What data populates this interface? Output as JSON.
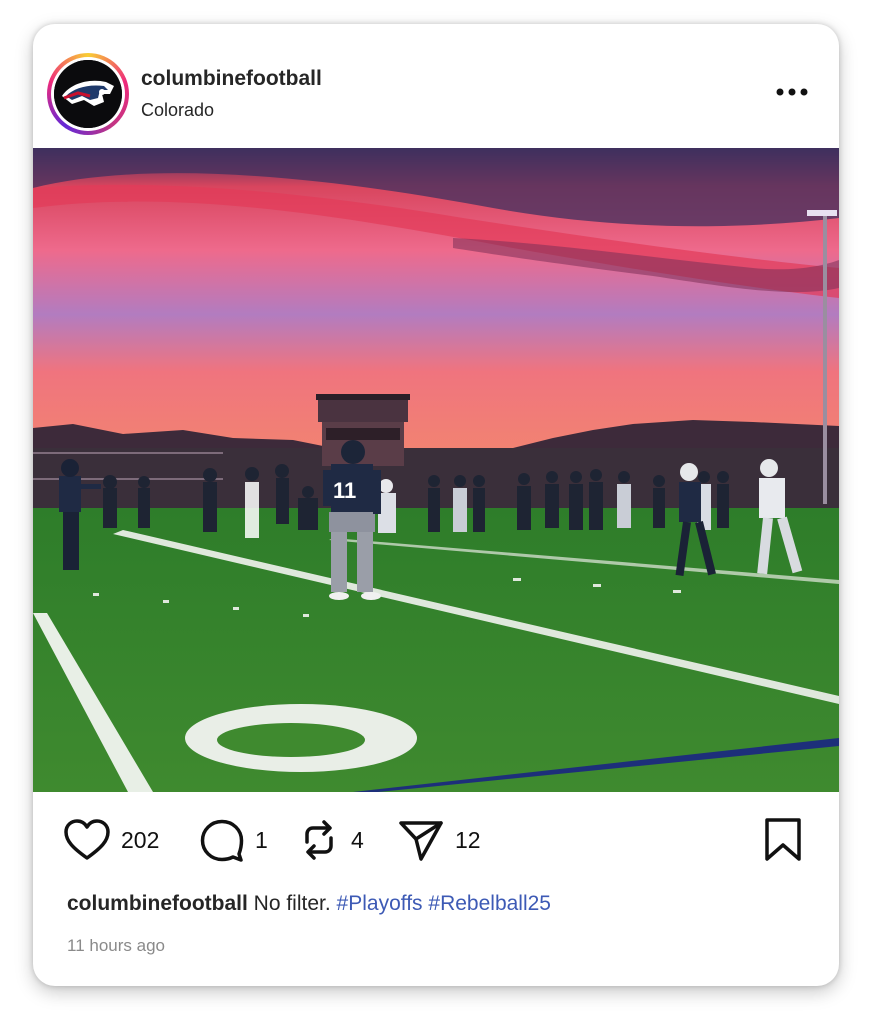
{
  "post": {
    "username": "columbinefootball",
    "location": "Colorado",
    "likes": "202",
    "comments": "1",
    "reposts": "4",
    "shares": "12",
    "caption_user": "columbinefootball",
    "caption_text": "No filter.",
    "hashtags": [
      "#Playoffs",
      "#Rebelball25"
    ],
    "time_ago": "11 hours ago",
    "jersey_number": "11",
    "yard_marker": "0"
  },
  "icons": {
    "more": "more-options-icon",
    "like": "heart-icon",
    "comment": "comment-icon",
    "repost": "repost-icon",
    "share": "send-icon",
    "save": "bookmark-icon"
  },
  "colors": {
    "text": "#262626",
    "hashtag": "#3d5ab5",
    "timestamp": "#8a8a8a",
    "ring_start": "#f9ce34",
    "ring_mid": "#ee2a7b"
  }
}
